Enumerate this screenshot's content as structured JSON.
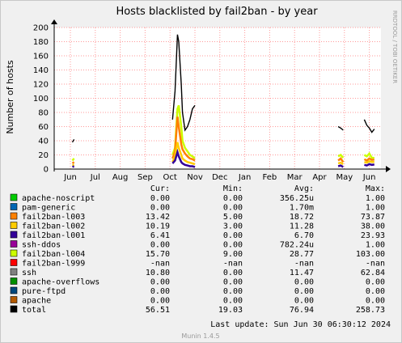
{
  "chart_data": {
    "type": "line",
    "title": "Hosts blacklisted by fail2ban - by year",
    "ylabel": "Number of hosts",
    "side_text": "RRDTOOL / TOBI OETIKER",
    "version": "Munin 1.4.5",
    "ylim": [
      0,
      200
    ],
    "yticks": [
      0,
      20,
      40,
      60,
      80,
      100,
      120,
      140,
      160,
      180,
      200
    ],
    "xticks": [
      "Jun",
      "Jul",
      "Aug",
      "Sep",
      "Oct",
      "Nov",
      "Dec",
      "Jan",
      "Feb",
      "Mar",
      "Apr",
      "May",
      "Jun"
    ],
    "grid": true,
    "legend_header": {
      "cur": "Cur:",
      "min": "Min:",
      "avg": "Avg:",
      "max": "Max:"
    },
    "series": [
      {
        "name": "apache-noscript",
        "color": "#00cc00",
        "cur": "0.00",
        "min": "0.00",
        "avg": "356.25u",
        "max": "1.00"
      },
      {
        "name": "pam-generic",
        "color": "#0066b3",
        "cur": "0.00",
        "min": "0.00",
        "avg": "1.70m",
        "max": "1.00"
      },
      {
        "name": "fail2ban-l003",
        "color": "#ff8000",
        "cur": "13.42",
        "min": "5.00",
        "avg": "18.72",
        "max": "73.87"
      },
      {
        "name": "fail2ban-l002",
        "color": "#ffcc00",
        "cur": "10.19",
        "min": "3.00",
        "avg": "11.28",
        "max": "38.00"
      },
      {
        "name": "fail2ban-l001",
        "color": "#330099",
        "cur": "6.41",
        "min": "0.00",
        "avg": "6.70",
        "max": "23.93"
      },
      {
        "name": "ssh-ddos",
        "color": "#990099",
        "cur": "0.00",
        "min": "0.00",
        "avg": "782.24u",
        "max": "1.00"
      },
      {
        "name": "fail2ban-l004",
        "color": "#ccff00",
        "cur": "15.70",
        "min": "9.00",
        "avg": "28.77",
        "max": "103.00"
      },
      {
        "name": "fail2ban-l999",
        "color": "#ff0000",
        "cur": "-nan",
        "min": "-nan",
        "avg": "-nan",
        "max": "-nan"
      },
      {
        "name": "ssh",
        "color": "#808080",
        "cur": "10.80",
        "min": "0.00",
        "avg": "11.47",
        "max": "62.84"
      },
      {
        "name": "apache-overflows",
        "color": "#008f00",
        "cur": "0.00",
        "min": "0.00",
        "avg": "0.00",
        "max": "0.00"
      },
      {
        "name": "pure-ftpd",
        "color": "#00487d",
        "cur": "0.00",
        "min": "0.00",
        "avg": "0.00",
        "max": "0.00"
      },
      {
        "name": "apache",
        "color": "#b35a00",
        "cur": "0.00",
        "min": "0.00",
        "avg": "0.00",
        "max": "0.00"
      },
      {
        "name": "total",
        "color": "#000000",
        "cur": "56.51",
        "min": "19.03",
        "avg": "76.94",
        "max": "258.73"
      }
    ],
    "last_update": "Last update:  Sun Jun 30 06:30:12 2024",
    "data_segments": [
      {
        "x": [
          0.08,
          0.15
        ],
        "l004": [
          12,
          15
        ],
        "l003": [
          8,
          10
        ],
        "l002": [
          5,
          6
        ],
        "l001": [
          3,
          4
        ],
        "total": [
          38,
          42
        ]
      },
      {
        "x": [
          4.1,
          4.2,
          4.3,
          4.35,
          4.45,
          4.5,
          4.6,
          4.7,
          4.8,
          4.9,
          5.0
        ],
        "l004": [
          20,
          30,
          85,
          90,
          60,
          40,
          30,
          25,
          20,
          18,
          15
        ],
        "l003": [
          15,
          25,
          74,
          60,
          35,
          28,
          22,
          18,
          15,
          14,
          12
        ],
        "l002": [
          10,
          18,
          38,
          30,
          20,
          15,
          12,
          10,
          9,
          8,
          7
        ],
        "l001": [
          8,
          12,
          24,
          18,
          10,
          8,
          6,
          5,
          4,
          4,
          3
        ],
        "total": [
          70,
          110,
          190,
          180,
          120,
          80,
          55,
          60,
          70,
          85,
          90
        ]
      },
      {
        "x": [
          10.75,
          10.85,
          10.95
        ],
        "l004": [
          18,
          20,
          16
        ],
        "l003": [
          12,
          15,
          10
        ],
        "l002": [
          8,
          9,
          7
        ],
        "l001": [
          4,
          5,
          3
        ],
        "total": [
          60,
          58,
          55
        ]
      },
      {
        "x": [
          11.8,
          11.9,
          12.0,
          12.1,
          12.2
        ],
        "l004": [
          20,
          18,
          22,
          16,
          15.7
        ],
        "l003": [
          14,
          12,
          15,
          13,
          13.42
        ],
        "l002": [
          10,
          9,
          11,
          10,
          10.19
        ],
        "l001": [
          6,
          5,
          7,
          6,
          6.41
        ],
        "total": [
          70,
          62,
          58,
          52,
          56.51
        ]
      }
    ]
  }
}
